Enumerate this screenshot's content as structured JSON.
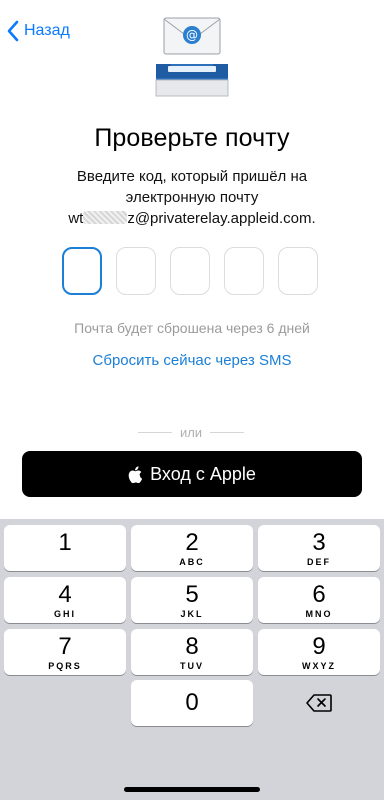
{
  "nav": {
    "back_label": "Назад"
  },
  "title": "Проверьте почту",
  "subtitle": {
    "line1": "Введите код, который пришёл на",
    "line2": "электронную почту",
    "email_prefix": "wt",
    "email_suffix": "z@privaterelay.appleid.com."
  },
  "code": {
    "length": 5,
    "values": [
      "",
      "",
      "",
      "",
      ""
    ],
    "active_index": 0
  },
  "hint": "Почта будет сброшена через 6 дней",
  "sms_link": "Сбросить сейчас через SMS",
  "divider": "или",
  "apple_button": {
    "label": "Вход с Apple"
  },
  "keypad": {
    "keys": [
      {
        "digit": "1",
        "letters": ""
      },
      {
        "digit": "2",
        "letters": "ABC"
      },
      {
        "digit": "3",
        "letters": "DEF"
      },
      {
        "digit": "4",
        "letters": "GHI"
      },
      {
        "digit": "5",
        "letters": "JKL"
      },
      {
        "digit": "6",
        "letters": "MNO"
      },
      {
        "digit": "7",
        "letters": "PQRS"
      },
      {
        "digit": "8",
        "letters": "TUV"
      },
      {
        "digit": "9",
        "letters": "WXYZ"
      },
      {
        "digit": "0",
        "letters": ""
      }
    ],
    "delete_icon": "backspace-icon"
  },
  "colors": {
    "accent": "#0a7aff",
    "link": "#1b7fd6",
    "keypad_bg": "#d3d4d9"
  }
}
